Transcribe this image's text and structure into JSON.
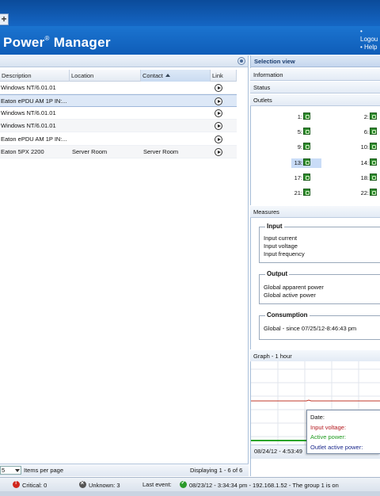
{
  "header": {
    "tab_plus": "+",
    "title": "Power",
    "title_reg": "®",
    "title_rest": " Manager",
    "links": [
      "• Logou",
      "• Help"
    ]
  },
  "grid": {
    "columns": [
      "Description",
      "Location",
      "Contact",
      "Link"
    ],
    "rows": [
      {
        "description": "Windows NT/6.01.01",
        "location": "",
        "contact": ""
      },
      {
        "description": "Eaton ePDU AM 1P IN:...",
        "location": "",
        "contact": ""
      },
      {
        "description": "Windows NT/6.01.01",
        "location": "",
        "contact": ""
      },
      {
        "description": "Windows NT/6.01.01",
        "location": "",
        "contact": ""
      },
      {
        "description": "Eaton ePDU AM 1P IN:...",
        "location": "",
        "contact": ""
      },
      {
        "description": "Eaton 5PX 2200",
        "location": "Server Room",
        "contact": "Server Room"
      }
    ]
  },
  "pager": {
    "page_size": "5",
    "items_per_page": "Items per page",
    "displaying": "Displaying 1 - 6 of 6"
  },
  "selection_view": {
    "title": "Selection view",
    "sections": [
      "Information",
      "Status",
      "Outlets"
    ],
    "outlets": [
      "1:",
      "2:",
      "5:",
      "6:",
      "9:",
      "10:",
      "13:",
      "14:",
      "17:",
      "18:",
      "21:",
      "22:"
    ],
    "selected_outlet": "13:",
    "measures_label": "Measures",
    "input": {
      "legend": "Input",
      "lines": [
        "Input current",
        "Input voltage",
        "Input frequency"
      ]
    },
    "output": {
      "legend": "Output",
      "lines": [
        "Global apparent power",
        "Global active power"
      ]
    },
    "consumption": {
      "legend": "Consumption",
      "lines": [
        "Global - since 07/25/12-8:46:43 pm"
      ]
    },
    "graph_label": "Graph - 1 hour",
    "graph_footer": "08/24/12 - 4:53:49",
    "tooltip": {
      "date": "Date:",
      "input_voltage": "Input voltage:",
      "active_power": "Active power:",
      "outlet_active_power": "Outlet active power:"
    }
  },
  "statusbar": {
    "critical": "Critical: 0",
    "unknown": "Unknown: 3",
    "last_event_label": "Last event:",
    "last_event": "08/23/12 - 3:34:34 pm - 192.168.1.52 - The group 1 is on"
  },
  "colors": {
    "header_blue": "#1566c4",
    "input_voltage": "#b3171d",
    "active_power": "#1f9a1f",
    "outlet_active_power": "#1c2a8c"
  }
}
